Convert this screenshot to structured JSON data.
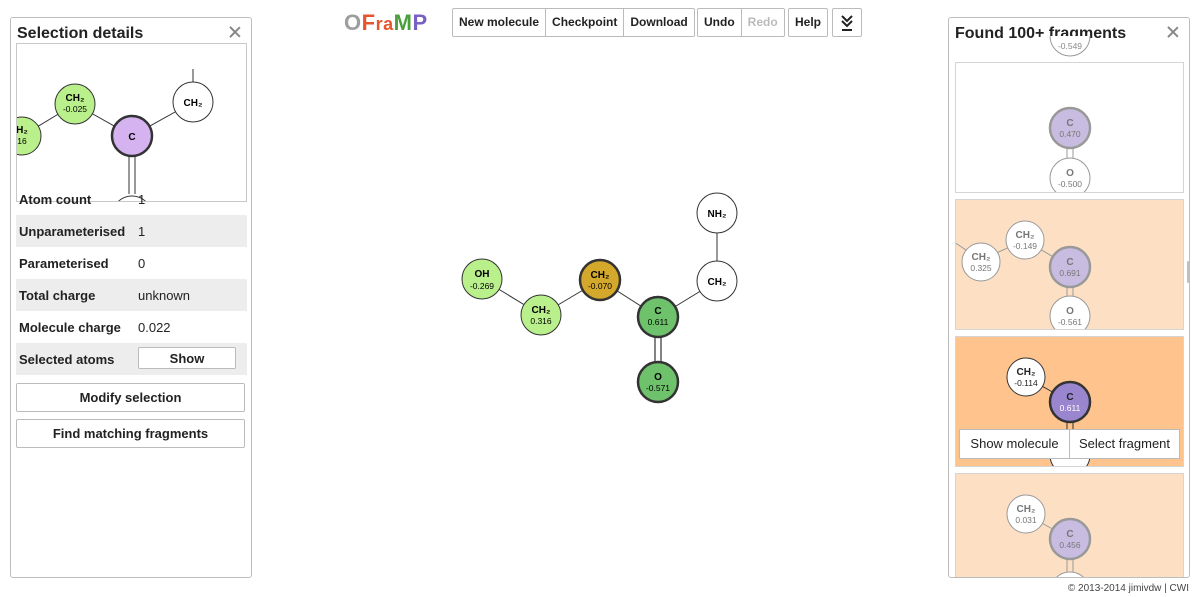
{
  "app": {
    "logo_letters": [
      "O",
      "F",
      "r",
      "a",
      "M",
      "P"
    ],
    "logo_colors": [
      "#9e9e9e",
      "#e5552e",
      "#e5552e",
      "#e5552e",
      "#4a9e3c",
      "#7a5fc4"
    ]
  },
  "toolbar": {
    "new_molecule": "New molecule",
    "checkpoint": "Checkpoint",
    "download": "Download",
    "undo": "Undo",
    "redo": "Redo",
    "help": "Help",
    "expand_icon": "double-chevron-down-icon"
  },
  "left_panel": {
    "title": "Selection details",
    "mini_atoms": [
      {
        "label": "CH₂",
        "charge": "-0.025"
      },
      {
        "label": "C",
        "charge": ""
      },
      {
        "label": "CH₂",
        "charge": ""
      },
      {
        "label": "H₂",
        "charge": "16"
      }
    ],
    "properties": [
      {
        "key": "Atom count",
        "value": "1"
      },
      {
        "key": "Unparameterised",
        "value": "1"
      },
      {
        "key": "Parameterised",
        "value": "0"
      },
      {
        "key": "Total charge",
        "value": "unknown"
      },
      {
        "key": "Molecule charge",
        "value": "0.022"
      },
      {
        "key": "Selected atoms",
        "value": ""
      }
    ],
    "show_button": "Show",
    "modify_selection": "Modify selection",
    "find_matching": "Find matching fragments"
  },
  "molecule": {
    "atoms": [
      {
        "id": "oh",
        "label": "OH",
        "charge": "-0.269"
      },
      {
        "id": "ch2a",
        "label": "CH₂",
        "charge": "0.316"
      },
      {
        "id": "ch2b",
        "label": "CH₂",
        "charge": "-0.070"
      },
      {
        "id": "c",
        "label": "C",
        "charge": "0.611"
      },
      {
        "id": "o",
        "label": "O",
        "charge": "-0.571"
      },
      {
        "id": "ch2c",
        "label": "CH₂",
        "charge": ""
      },
      {
        "id": "nh2",
        "label": "NH₂",
        "charge": ""
      }
    ],
    "colors": {
      "green": "#b9f08c",
      "selected": "#d4a82a",
      "carbon": "#6dc26b",
      "white": "#ffffff"
    }
  },
  "right_panel": {
    "title": "Found 100+ fragments",
    "top_partial_charge": "-0.549",
    "fragments": [
      {
        "atoms": [
          {
            "label": "C",
            "charge": "0.470"
          },
          {
            "label": "O",
            "charge": "-0.500"
          }
        ]
      },
      {
        "atoms": [
          {
            "label": "CH₂",
            "charge": "-0.149"
          },
          {
            "label": "CH₂",
            "charge": "0.325"
          },
          {
            "label": "C",
            "charge": "0.691"
          },
          {
            "label": "O",
            "charge": "-0.561"
          }
        ]
      },
      {
        "atoms": [
          {
            "label": "CH₂",
            "charge": "-0.114"
          },
          {
            "label": "C",
            "charge": "0.611"
          }
        ]
      },
      {
        "atoms": [
          {
            "label": "CH₂",
            "charge": "0.031"
          },
          {
            "label": "C",
            "charge": "0.456"
          }
        ]
      }
    ],
    "show_molecule": "Show molecule",
    "select_fragment": "Select fragment"
  },
  "footer": "© 2013-2014 jimivdw | CWI"
}
